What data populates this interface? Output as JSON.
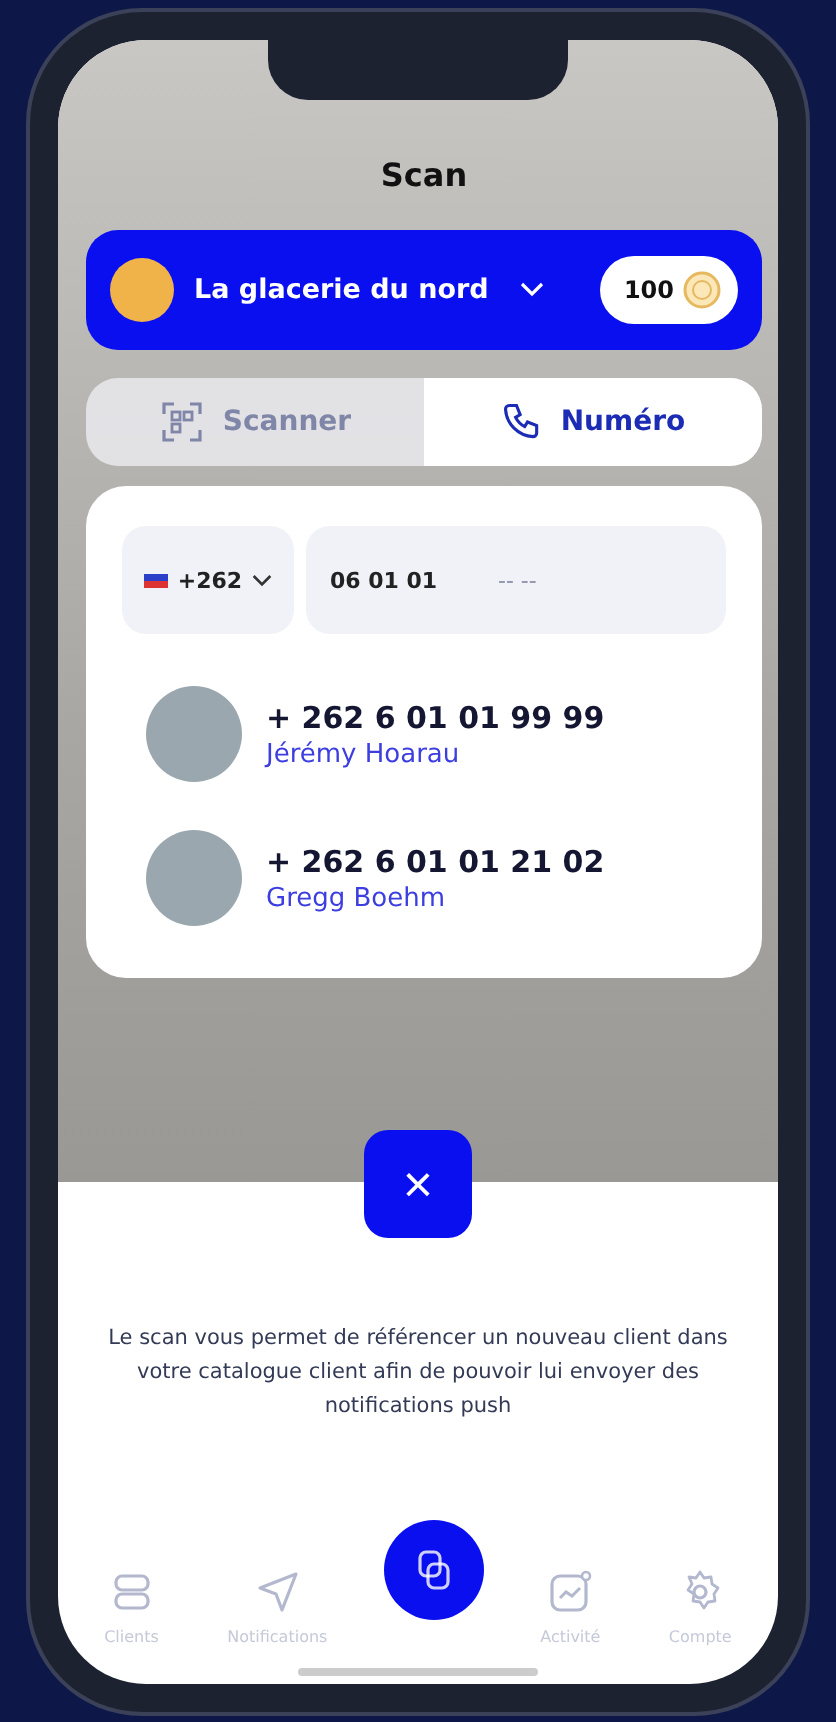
{
  "title": "Scan",
  "merchant": {
    "name": "La glacerie du nord",
    "points": "100"
  },
  "tabs": [
    {
      "label": "Scanner",
      "selected": false,
      "kind": "scan"
    },
    {
      "label": "Numéro",
      "selected": true,
      "kind": "phone"
    }
  ],
  "phone_input": {
    "country_code": "+262",
    "value": "06 01 01",
    "mask": "-- --"
  },
  "contacts": [
    {
      "phone": "+ 262 6 01 01 99 99",
      "name": "Jérémy Hoarau"
    },
    {
      "phone": "+ 262 6 01 01 21 02",
      "name": "Gregg Boehm"
    }
  ],
  "close_button": "×",
  "description": "Le scan vous permet de référencer un nouveau client dans votre catalogue client afin de pouvoir lui envoyer des notifications push",
  "nav": [
    {
      "label": "Clients",
      "kind": "clients"
    },
    {
      "label": "Notifications",
      "kind": "notifications"
    },
    {
      "kind": "scan"
    },
    {
      "label": "Activité",
      "kind": "activity"
    },
    {
      "label": "Compte",
      "kind": "account"
    }
  ]
}
